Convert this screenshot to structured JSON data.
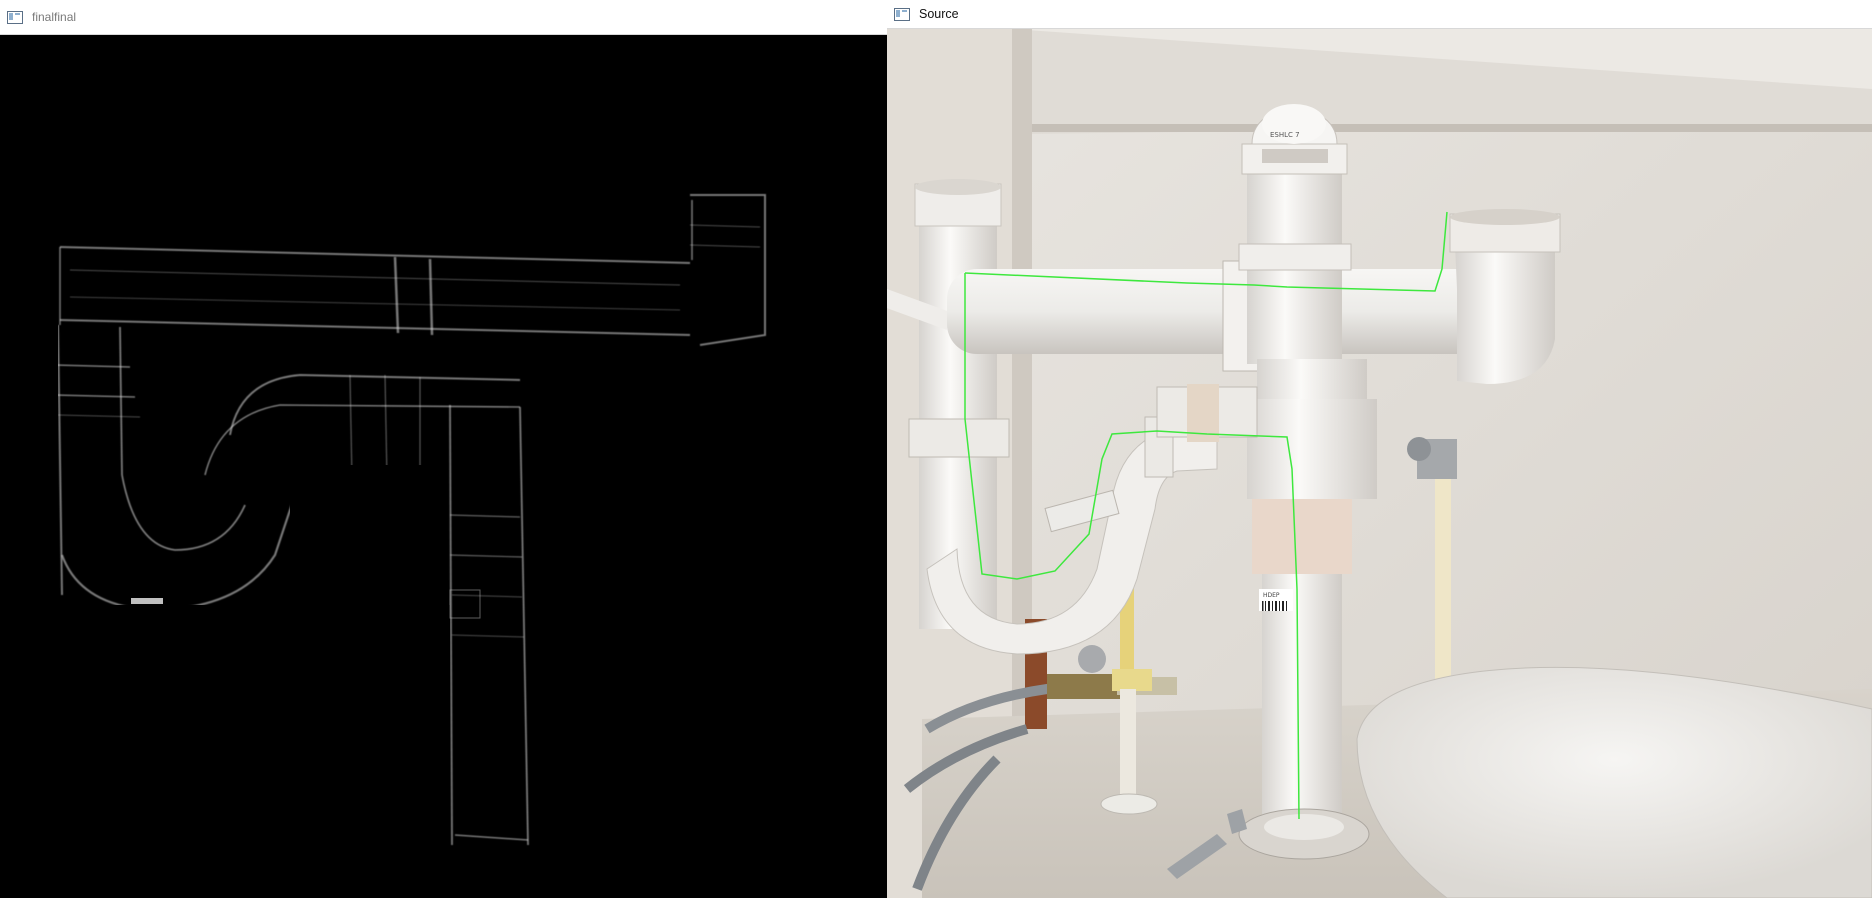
{
  "windows": {
    "final": {
      "title": "finalfinal",
      "content": "edge-detected grayscale image of drain pipes"
    },
    "source": {
      "title": "Source",
      "content": "photo of white PVC drain pipes under a sink with green traced path overlay",
      "overlay_color": "#3ee83e"
    }
  },
  "colors": {
    "edge": "#e8e8e8",
    "pipe_white": "#f1efec",
    "wall": "#e5e1db"
  },
  "labels": {
    "pipe_text_top": "ESHLC 7",
    "barcode_text": "HDEP"
  }
}
